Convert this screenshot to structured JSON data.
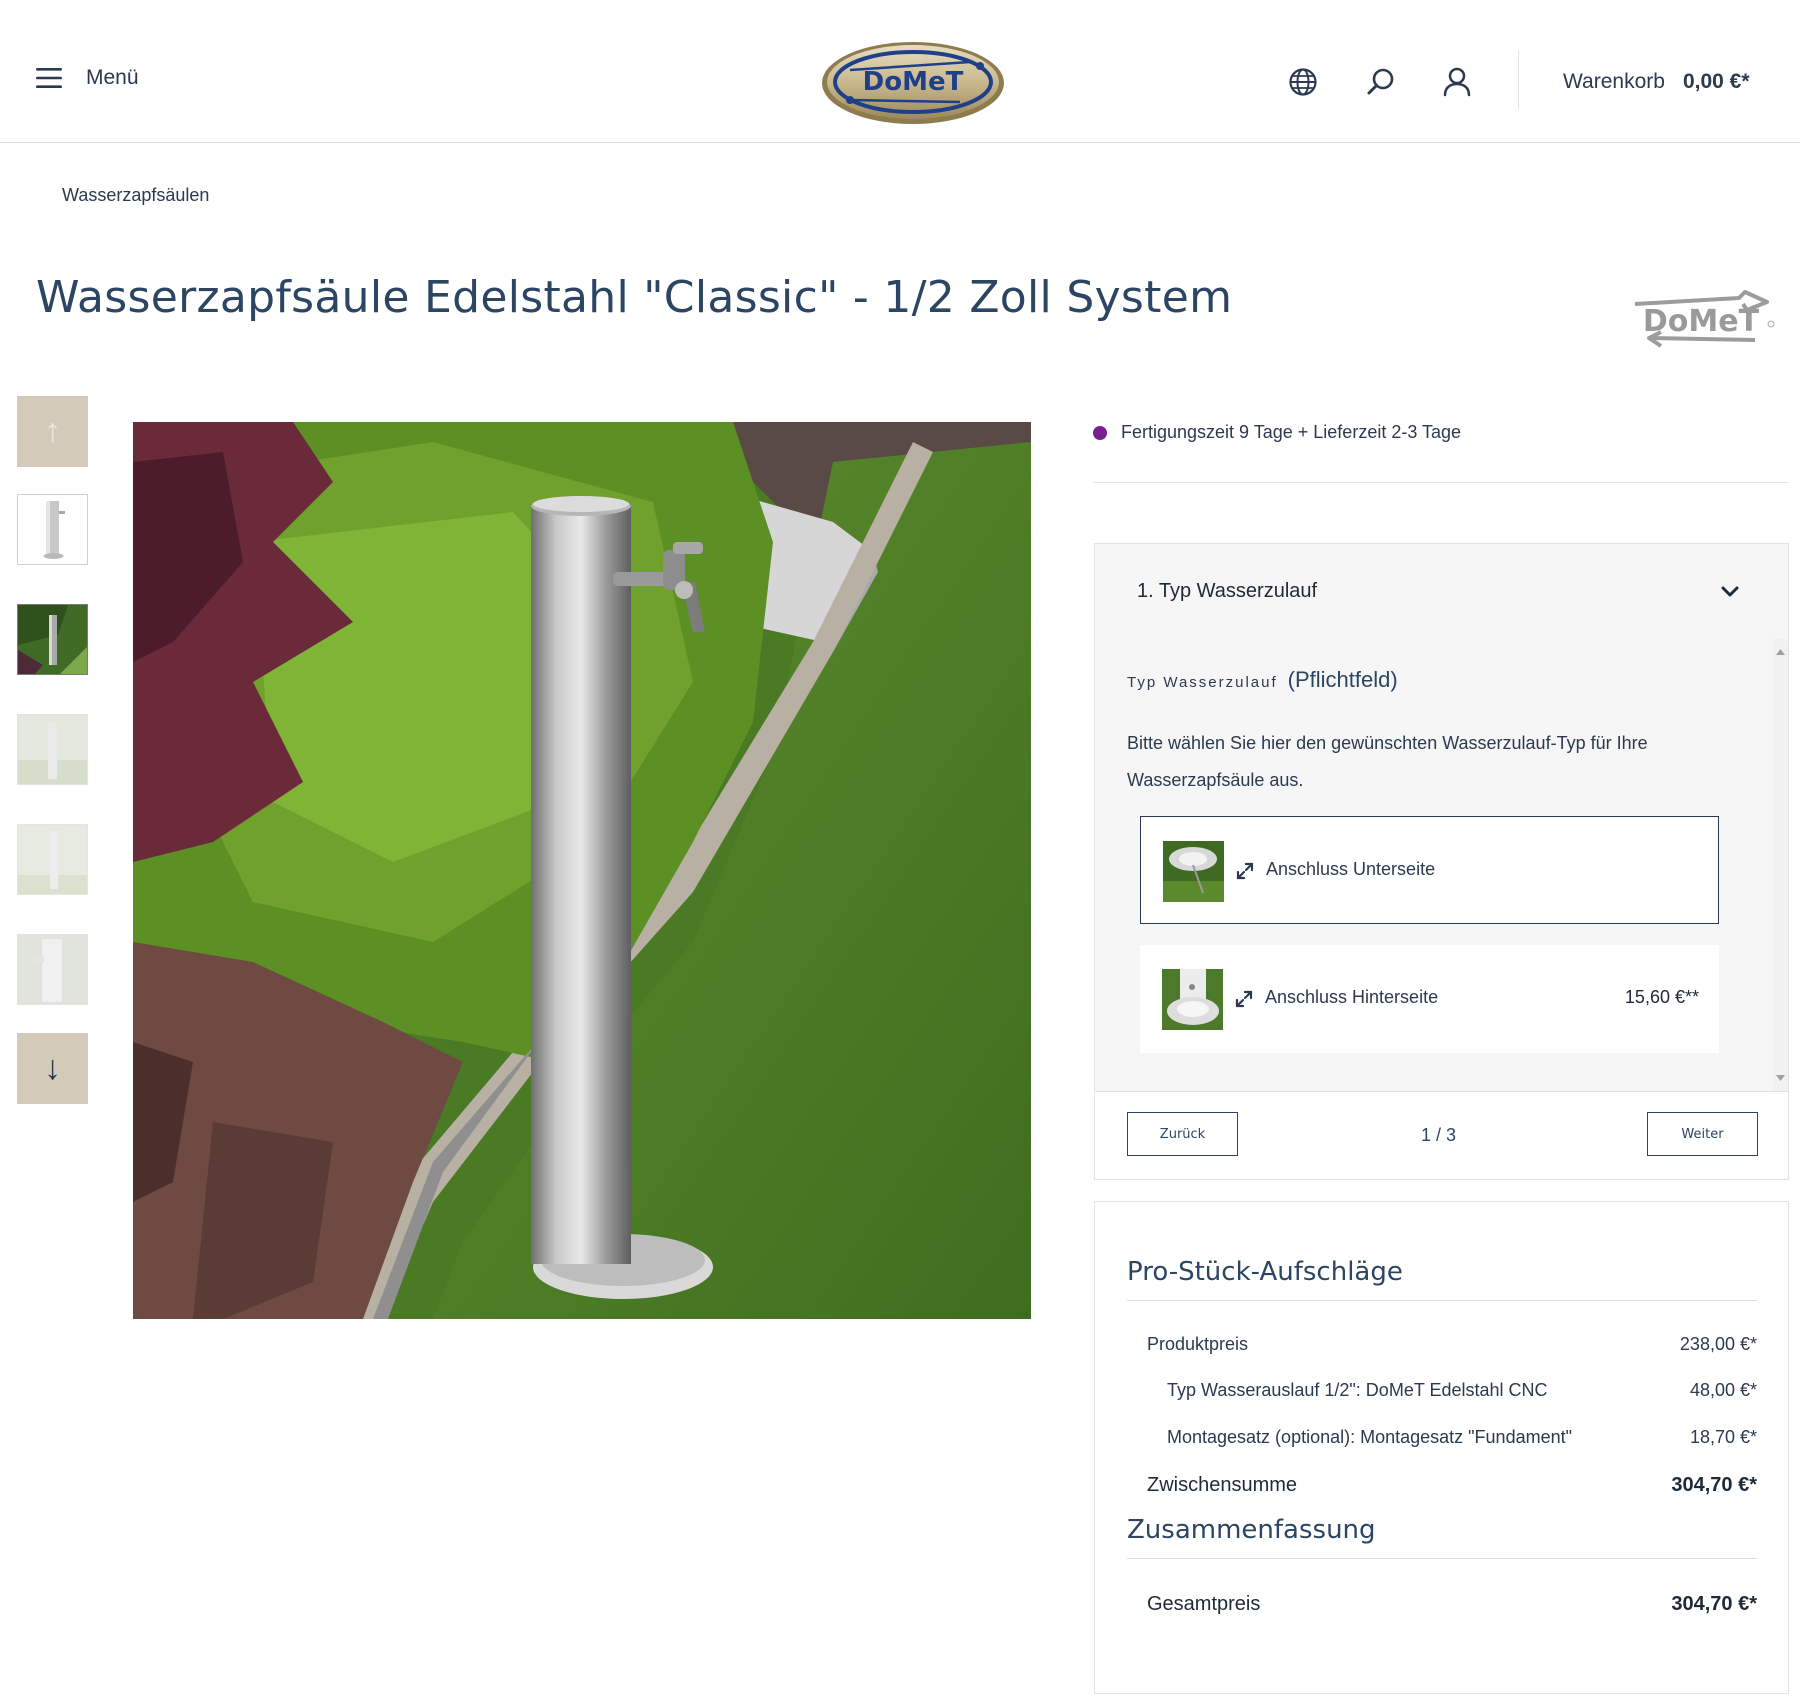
{
  "header": {
    "menu_label": "Menü",
    "logo_text": "DoMeT",
    "cart_label": "Warenkorb",
    "cart_total": "0,00 €*"
  },
  "breadcrumb": "Wasserzapfsäulen",
  "product": {
    "title": "Wasserzapfsäule Edelstahl \"Classic\" - 1/2 Zoll System",
    "brand_logo_text": "DoMeT"
  },
  "gallery": {
    "up_arrow": "↑",
    "down_arrow": "↓"
  },
  "delivery": {
    "text": "Fertigungszeit 9 Tage + Lieferzeit 2-3 Tage",
    "status_color": "#7a1f8f"
  },
  "configurator": {
    "step_title": "1. Typ Wasserzulauf",
    "field_name": "Typ Wasserzulauf",
    "field_required": "(Pflichtfeld)",
    "description": "Bitte wählen Sie hier den gewünschten Wasserzulauf-Typ für Ihre Wasserzapfsäule aus.",
    "options": [
      {
        "label": "Anschluss Unterseite",
        "price": ""
      },
      {
        "label": "Anschluss Hinterseite",
        "price": "15,60 €**"
      }
    ],
    "back_label": "Zurück",
    "next_label": "Weiter",
    "step_counter": "1 / 3"
  },
  "summary": {
    "surcharges_heading": "Pro-Stück-Aufschläge",
    "rows": [
      {
        "label": "Produktpreis",
        "value": "238,00 €*"
      },
      {
        "label": "Typ Wasserauslauf 1/2\": DoMeT Edelstahl CNC",
        "value": "48,00 €*"
      },
      {
        "label": "Montagesatz (optional): Montagesatz \"Fundament\"",
        "value": "18,70 €*"
      }
    ],
    "subtotal_label": "Zwischensumme",
    "subtotal_value": "304,70 €*",
    "summary_heading": "Zusammenfassung",
    "total_label": "Gesamtpreis",
    "total_value": "304,70 €*"
  },
  "colors": {
    "primary_text": "#2b3a4f",
    "heading": "#2b4563",
    "thumb_nav_bg": "#d4cab9"
  }
}
